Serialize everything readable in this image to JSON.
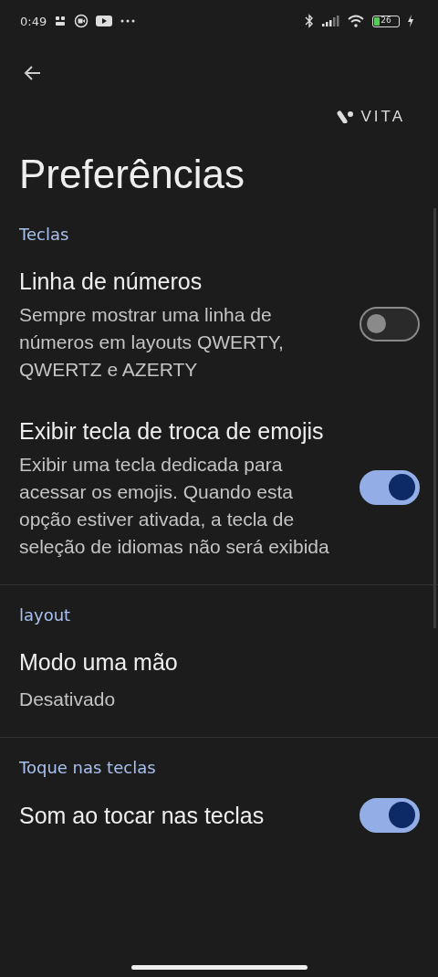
{
  "status_bar": {
    "time": "0:49",
    "battery": "26"
  },
  "brand": "VITA",
  "title": "Preferências",
  "sections": [
    {
      "header": "Teclas",
      "items": [
        {
          "kind": "toggle",
          "title": "Linha de números",
          "description": "Sempre mostrar uma linha de números em layouts QWERTY, QWERTZ e AZERTY",
          "on": false
        },
        {
          "kind": "toggle",
          "title": "Exibir tecla de troca de emojis",
          "description": "Exibir uma tecla dedicada para acessar os emojis. Quando esta opção estiver ativada, a tecla de seleção de idiomas não será exibida",
          "on": true
        }
      ]
    },
    {
      "header": "layout",
      "items": [
        {
          "kind": "value",
          "title": "Modo uma mão",
          "description": "Desativado"
        }
      ]
    },
    {
      "header": "Toque nas teclas",
      "items": [
        {
          "kind": "toggle",
          "title": "Som ao tocar nas teclas",
          "on": true
        }
      ]
    }
  ]
}
